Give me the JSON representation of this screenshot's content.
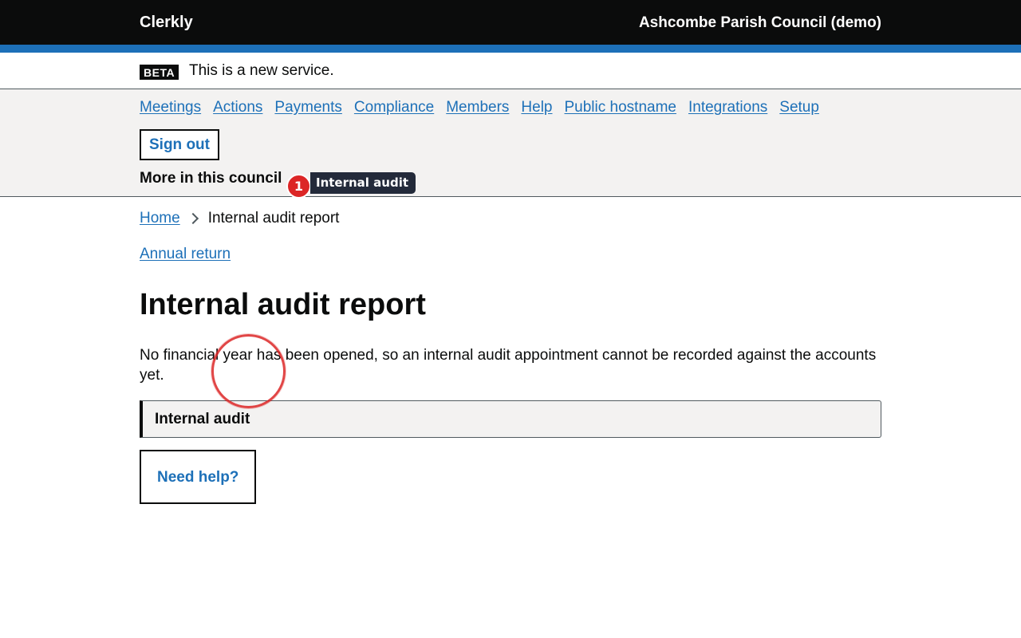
{
  "header": {
    "brand": "Clerkly",
    "organisation": "Ashcombe Parish Council (demo)"
  },
  "phase_banner": {
    "tag": "BETA",
    "text": "This is a new service."
  },
  "nav": {
    "items": [
      {
        "label": "Meetings"
      },
      {
        "label": "Actions"
      },
      {
        "label": "Payments"
      },
      {
        "label": "Compliance"
      },
      {
        "label": "Members"
      },
      {
        "label": "Help"
      },
      {
        "label": "Public hostname"
      },
      {
        "label": "Integrations"
      },
      {
        "label": "Setup"
      }
    ],
    "sign_out": "Sign out",
    "more_label": "More in this council"
  },
  "annotation": {
    "number": "1",
    "label": "Internal audit"
  },
  "breadcrumbs": {
    "home": "Home",
    "current": "Internal audit report"
  },
  "main": {
    "annual_return_link": "Annual return",
    "title": "Internal audit report",
    "lead": "No financial year has been opened, so an internal audit appointment cannot be recorded against the accounts yet.",
    "details_summary": "Internal audit",
    "help": "Need help?"
  },
  "colors": {
    "header_bg": "#0b0c0c",
    "link": "#1d70b8",
    "accent_bar": "#1d70b8",
    "panel_bg": "#f3f2f1",
    "annotation_red": "#dc2626"
  }
}
